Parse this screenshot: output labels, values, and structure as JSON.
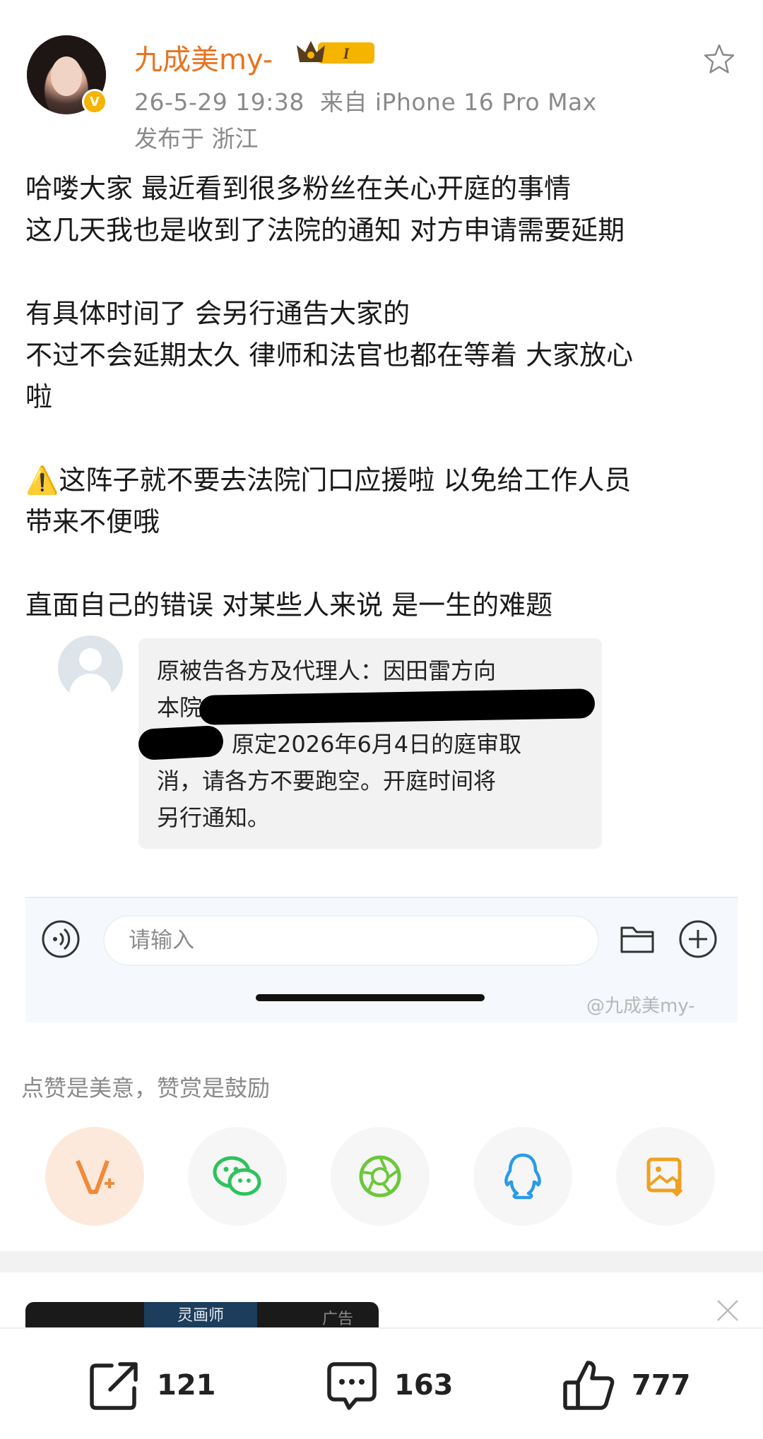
{
  "post": {
    "username": "九成美my-",
    "timestamp": "26-5-29 19:38",
    "source": "来自 iPhone 16 Pro Max",
    "location": "发布于 浙江",
    "level_label": "I",
    "lines": [
      "哈喽大家 最近看到很多粉丝在关心开庭的事情",
      "这几天我也是收到了法院的通知 对方申请需要延期",
      "",
      "有具体时间了 会另行通告大家的",
      "不过不会延期太久 律师和法官也都在等着 大家放心",
      "啦",
      "",
      "⚠️这阵子就不要去法院门口应援啦 以免给工作人员",
      "带来不便哦",
      "",
      "直面自己的错误 对某些人来说 是一生的难题"
    ]
  },
  "screenshot": {
    "bubble_lines": [
      "原被告各方及代理人：因田雷方向",
      "本院",
      "原定2026年6月4日的庭审取",
      "消，请各方不要跑空。开庭时间将",
      "另行通知。"
    ],
    "input_placeholder": "请输入",
    "watermark": "@九成美my-"
  },
  "reward_tip": "点赞是美意，赞赏是鼓励",
  "share_buttons": [
    "V+",
    "wechat",
    "moments",
    "qq",
    "save-image"
  ],
  "ad": {
    "thumb_text": "灵画师",
    "label": "广告"
  },
  "actions": {
    "repost_count": "121",
    "comment_count": "163",
    "like_count": "777"
  },
  "colors": {
    "username": "#e8731f",
    "meta": "#8a8a8a",
    "vip_orange": "#f08a3a",
    "wechat_green": "#2fc25b",
    "moments_green": "#6bc83a",
    "qq_blue": "#2a9be8",
    "save_orange": "#f0a020"
  }
}
